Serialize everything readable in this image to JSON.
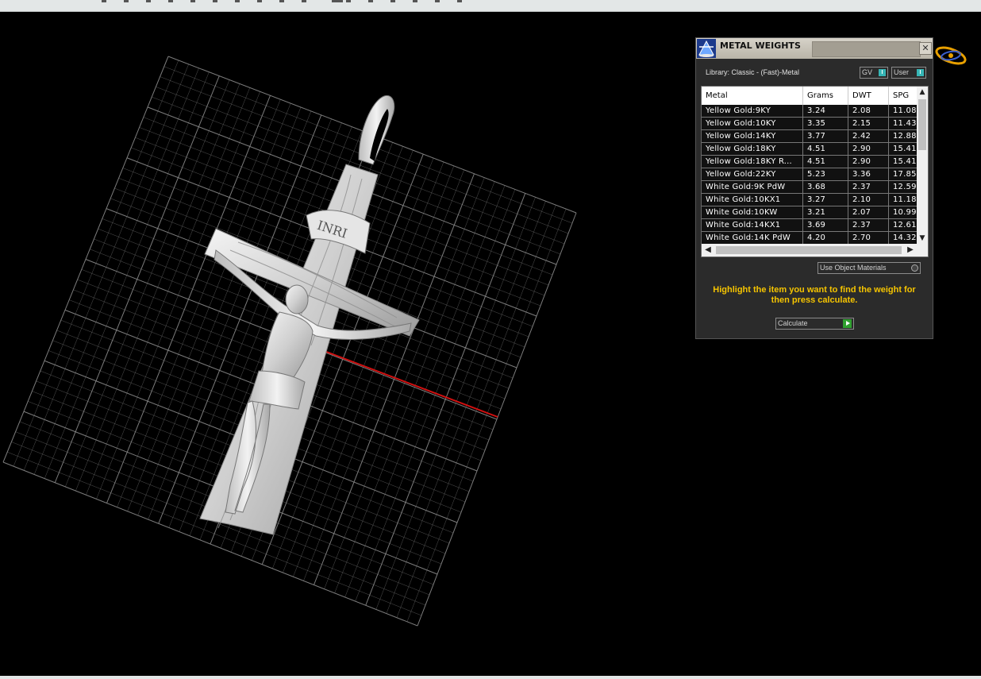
{
  "panel": {
    "title": "METAL WEIGHTS",
    "close_label": "✕",
    "library_label": "Library: Classic - (Fast)-Metal",
    "gv_label": "GV",
    "user_label": "User",
    "toggle_mark": "I",
    "columns": [
      "Metal",
      "Grams",
      "DWT",
      "SPG"
    ],
    "rows": [
      {
        "metal": "Yellow Gold:9KY",
        "grams": "3.24",
        "dwt": "2.08",
        "spg": "11.08"
      },
      {
        "metal": "Yellow Gold:10KY",
        "grams": "3.35",
        "dwt": "2.15",
        "spg": "11.43"
      },
      {
        "metal": "Yellow Gold:14KY",
        "grams": "3.77",
        "dwt": "2.42",
        "spg": "12.88"
      },
      {
        "metal": "Yellow Gold:18KY",
        "grams": "4.51",
        "dwt": "2.90",
        "spg": "15.41"
      },
      {
        "metal": "Yellow Gold:18KY R...",
        "grams": "4.51",
        "dwt": "2.90",
        "spg": "15.41"
      },
      {
        "metal": "Yellow Gold:22KY",
        "grams": "5.23",
        "dwt": "3.36",
        "spg": "17.85"
      },
      {
        "metal": "White Gold:9K PdW",
        "grams": "3.68",
        "dwt": "2.37",
        "spg": "12.59"
      },
      {
        "metal": "White Gold:10KX1",
        "grams": "3.27",
        "dwt": "2.10",
        "spg": "11.18"
      },
      {
        "metal": "White Gold:10KW",
        "grams": "3.21",
        "dwt": "2.07",
        "spg": "10.99"
      },
      {
        "metal": "White Gold:14KX1",
        "grams": "3.69",
        "dwt": "2.37",
        "spg": "12.61"
      },
      {
        "metal": "White Gold:14K PdW",
        "grams": "4.20",
        "dwt": "2.70",
        "spg": "14.32"
      }
    ],
    "use_object_materials_label": "Use Object Materials",
    "instruction": "Highlight the item you want to find the weight for then press calculate.",
    "calculate_label": "Calculate"
  },
  "viewport": {
    "axis_color": "#d01010",
    "grid_color": "#8a8a8a",
    "object": "crucifix-pendant",
    "inscription": "INRI"
  },
  "icons": {
    "panel_logo": "scale-pyramid-icon",
    "gizmo": "orbit-gizmo-icon"
  }
}
